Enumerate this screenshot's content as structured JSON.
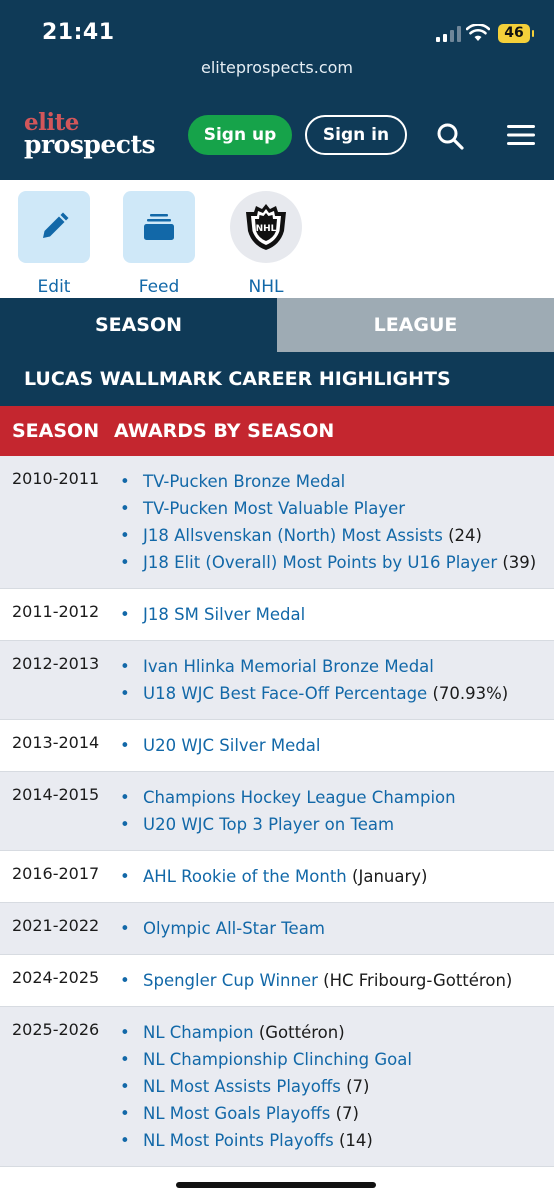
{
  "status_bar": {
    "time": "21:41",
    "battery": "46"
  },
  "browser": {
    "url": "eliteprospects.com"
  },
  "header": {
    "logo_line1": "elite",
    "logo_line2": "prospects",
    "signup_label": "Sign up",
    "signin_label": "Sign in"
  },
  "quick_actions": [
    {
      "label": "Edit",
      "icon": "pencil-icon"
    },
    {
      "label": "Feed",
      "icon": "feed-icon"
    },
    {
      "label": "NHL",
      "icon": "nhl-logo-icon"
    }
  ],
  "tabs": [
    {
      "label": "SEASON",
      "active": true
    },
    {
      "label": "LEAGUE",
      "active": false
    }
  ],
  "career_title": "LUCAS WALLMARK CAREER HIGHLIGHTS",
  "table": {
    "col_season": "SEASON",
    "col_awards": "AWARDS BY SEASON",
    "rows": [
      {
        "season": "2010-2011",
        "awards": [
          {
            "name": "TV-Pucken Bronze Medal",
            "note": ""
          },
          {
            "name": "TV-Pucken Most Valuable Player",
            "note": ""
          },
          {
            "name": "J18 Allsvenskan (North) Most Assists",
            "note": "(24)"
          },
          {
            "name": "J18 Elit (Overall) Most Points by U16 Player",
            "note": "(39)"
          }
        ]
      },
      {
        "season": "2011-2012",
        "awards": [
          {
            "name": "J18 SM Silver Medal",
            "note": ""
          }
        ]
      },
      {
        "season": "2012-2013",
        "awards": [
          {
            "name": "Ivan Hlinka Memorial Bronze Medal",
            "note": ""
          },
          {
            "name": "U18 WJC Best Face-Off Percentage",
            "note": "(70.93%)"
          }
        ]
      },
      {
        "season": "2013-2014",
        "awards": [
          {
            "name": "U20 WJC Silver Medal",
            "note": ""
          }
        ]
      },
      {
        "season": "2014-2015",
        "awards": [
          {
            "name": "Champions Hockey League Champion",
            "note": ""
          },
          {
            "name": "U20 WJC Top 3 Player on Team",
            "note": ""
          }
        ]
      },
      {
        "season": "2016-2017",
        "awards": [
          {
            "name": "AHL Rookie of the Month",
            "note": "(January)"
          }
        ]
      },
      {
        "season": "2021-2022",
        "awards": [
          {
            "name": "Olympic All-Star Team",
            "note": ""
          }
        ]
      },
      {
        "season": "2024-2025",
        "awards": [
          {
            "name": "Spengler Cup Winner",
            "note": "(HC Fribourg-Gottéron)"
          }
        ]
      },
      {
        "season": "2025-2026",
        "awards": [
          {
            "name": "NL Champion",
            "note": "(Gottéron)"
          },
          {
            "name": "NL Championship Clinching Goal",
            "note": ""
          },
          {
            "name": "NL Most Assists Playoffs",
            "note": "(7)"
          },
          {
            "name": "NL Most Goals Playoffs",
            "note": "(7)"
          },
          {
            "name": "NL Most Points Playoffs",
            "note": "(14)"
          }
        ]
      }
    ]
  },
  "colors": {
    "navy": "#0f3a57",
    "red": "#c4262f",
    "link": "#1268a8",
    "green": "#16a34a",
    "row_alt": "#e9ebf1"
  }
}
